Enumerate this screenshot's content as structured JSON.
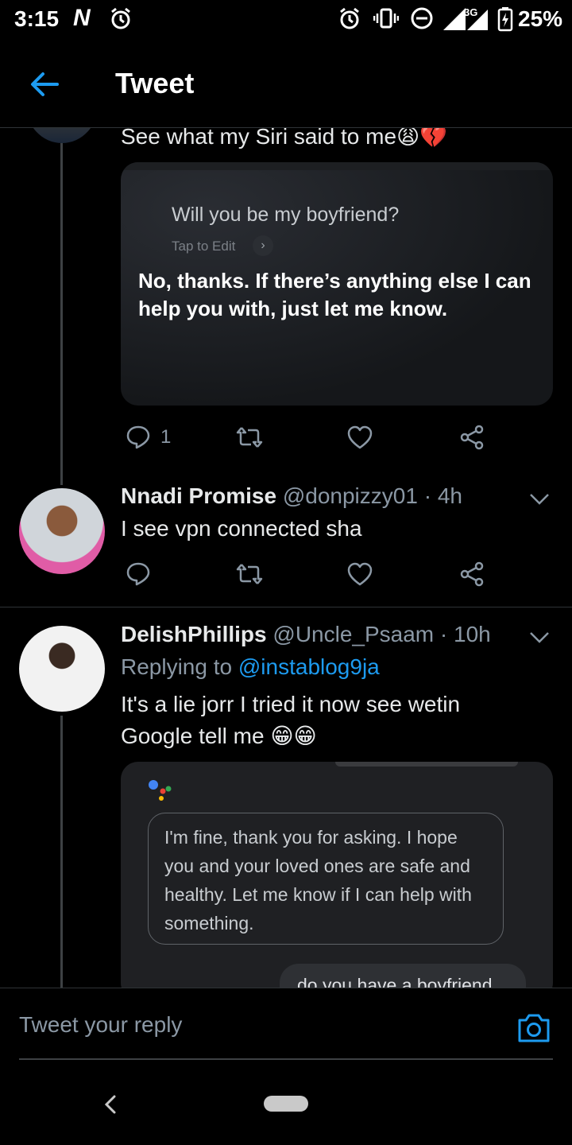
{
  "status_bar": {
    "time": "3:15",
    "carrier_badge": "N",
    "network": "3G",
    "battery": "25%"
  },
  "header": {
    "title": "Tweet"
  },
  "tweets": [
    {
      "text": "See what my Siri said to me😩💔",
      "media": {
        "question": "Will you be my boyfriend?",
        "tap_to_edit": "Tap to Edit",
        "answer": "No, thanks. If there’s anything else I can help you with, just let me know."
      },
      "reply_count": "1"
    },
    {
      "name": "Nnadi Promise",
      "handle": "@donpizzy01",
      "separator": " · ",
      "time": "4h",
      "text": "I see vpn connected sha"
    },
    {
      "name": "DelishPhillips",
      "handle": "@Uncle_Psaam",
      "separator": " · ",
      "time": "10h",
      "replying_prefix": "Replying to ",
      "replying_to": "@instablog9ja",
      "text_line1": "It's a lie jorr I tried it now see wetin",
      "text_line2": "Google tell me 😁😁",
      "media": {
        "assistant_reply": "I'm fine, thank you for asking. I hope you and your loved ones are safe and healthy. Let me know if I can help with something.",
        "user_query": "do you have a boyfriend"
      }
    }
  ],
  "reply_bar": {
    "placeholder": "Tweet your reply"
  },
  "colors": {
    "accent": "#1d9bf0",
    "background": "#000000",
    "secondary_text": "#8b98a5"
  }
}
